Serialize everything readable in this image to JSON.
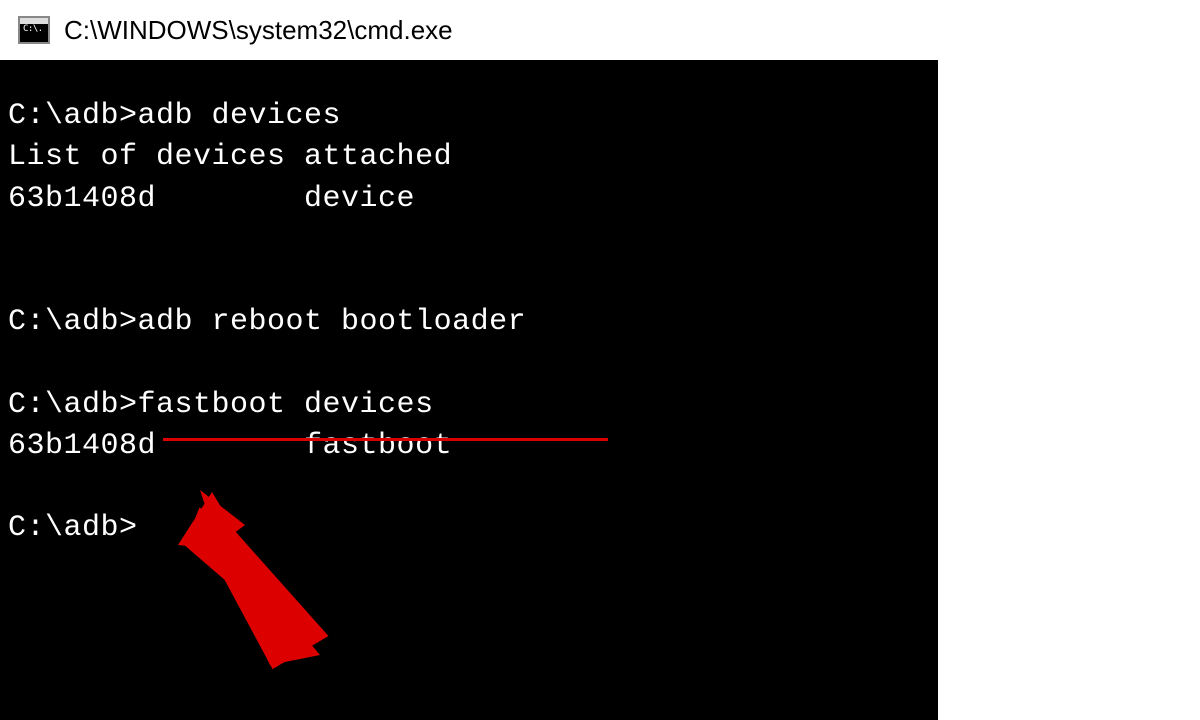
{
  "window": {
    "icon_label": "C:\\.",
    "title": "C:\\WINDOWS\\system32\\cmd.exe"
  },
  "terminal": {
    "lines": [
      "C:\\adb>adb devices",
      "List of devices attached",
      "63b1408d        device",
      "",
      "",
      "C:\\adb>adb reboot bootloader",
      "",
      "C:\\adb>fastboot devices",
      "63b1408d        fastboot",
      "",
      "C:\\adb>"
    ]
  },
  "annotations": {
    "underline_target": "fastboot devices",
    "arrow_color": "#dd0000"
  }
}
